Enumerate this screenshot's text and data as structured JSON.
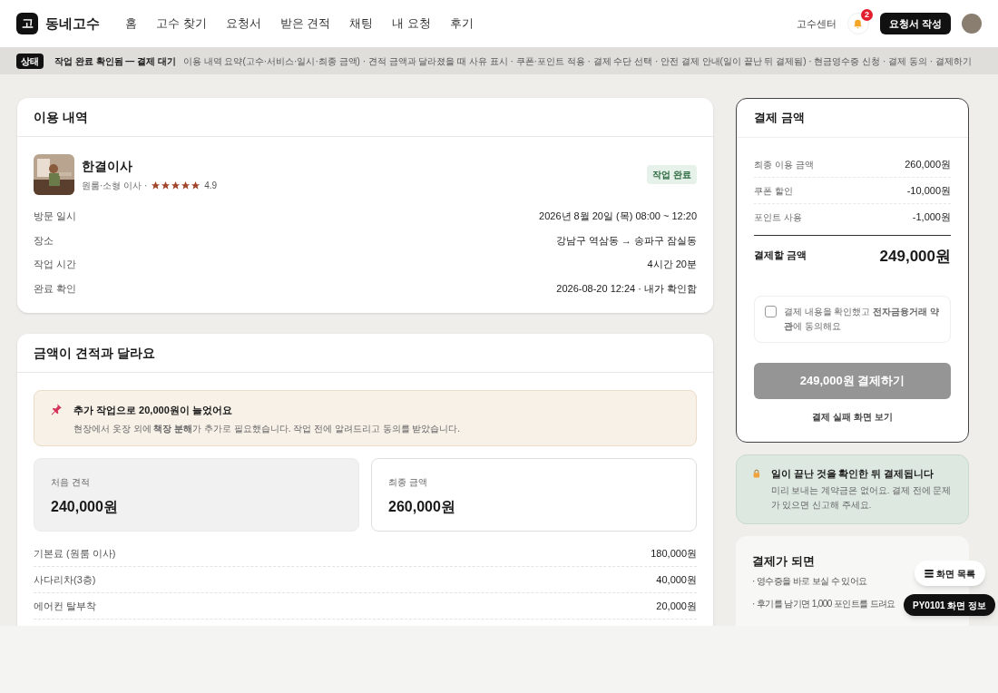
{
  "header": {
    "logo_mark": "고",
    "logo_text": "동네고수",
    "nav": [
      "홈",
      "고수 찾기",
      "요청서",
      "받은 견적",
      "채팅",
      "내 요청",
      "후기"
    ],
    "pro_center": "고수센터",
    "notification_count": "2",
    "cta": "요청서 작성"
  },
  "status_bar": {
    "badge": "상태",
    "title": "작업 완료 확인됨 — 결제 대기",
    "description": "이용 내역 요약(고수·서비스·일시·최종 금액) · 견적 금액과 달라졌을 때 사유 표시 · 쿠폰·포인트 적용 · 결제 수단 선택 · 안전 결제 안내(일이 끝난 뒤 결제됨) · 현금영수증 신청 · 결제 동의 · 결제하기"
  },
  "usage": {
    "title": "이용 내역",
    "provider": {
      "name": "한결이사",
      "service": "원룸·소형 이사 ·",
      "stars": 5,
      "rating": "4.9",
      "status": "작업 완료"
    },
    "details": [
      {
        "label": "방문 일시",
        "value": "2026년 8월 20일 (목) 08:00 ~ 12:20"
      },
      {
        "label": "장소",
        "value": "강남구 역삼동 → 송파구 잠실동"
      },
      {
        "label": "작업 시간",
        "value": "4시간 20분"
      },
      {
        "label": "완료 확인",
        "value": "2026-08-20 12:24 · 내가 확인함"
      }
    ]
  },
  "difference": {
    "title": "금액이 견적과 달라요",
    "notice": {
      "title": "추가 작업으로 20,000원이 늘었어요",
      "body": "현장에서 옷장 외에 **책장 분해**가 추가로 필요했습니다. 작업 전에 알려드리고 동의를 받았습니다."
    },
    "compare": [
      {
        "label": "처음 견적",
        "amount": "240,000원",
        "selected": false
      },
      {
        "label": "최종 금액",
        "amount": "260,000원",
        "selected": true
      }
    ],
    "items": [
      {
        "label": "기본료 (원룸 이사)",
        "amount": "180,000원"
      },
      {
        "label": "사다리차(3층)",
        "amount": "40,000원"
      },
      {
        "label": "에어컨 탈부착",
        "amount": "20,000원"
      }
    ]
  },
  "payment": {
    "title": "결제 금액",
    "lines": [
      {
        "label": "최종 이용 금액",
        "amount": "260,000원"
      },
      {
        "label": "쿠폰 할인",
        "amount": "-10,000원"
      },
      {
        "label": "포인트 사용",
        "amount": "-1,000원"
      }
    ],
    "total_label": "결제할 금액",
    "total": "249,000원",
    "agreement": {
      "text": "결제 내용을 확인했고 **전자금융거래 약관**에 동의해요",
      "checked": false
    },
    "pay_button": {
      "label": "249,000원 결제하기",
      "disabled": true
    },
    "fail_link": "결제 실패 화면 보기"
  },
  "safe_notice": {
    "title": "일이 끝난 것을 확인한 뒤 결제됩니다",
    "body": "미리 보내는 계약금은 없어요. 결제 전에 문제가 있으면 신고해 주세요."
  },
  "after": {
    "title": "결제가 되면",
    "bullets": [
      "· 영수증을 바로 보실 수 있어요",
      "· 후기를 남기면 1,000 포인트를 드려요"
    ]
  },
  "floating": {
    "list_button": "☰ 화면 목록",
    "info_button": "PY0101 화면 정보"
  }
}
